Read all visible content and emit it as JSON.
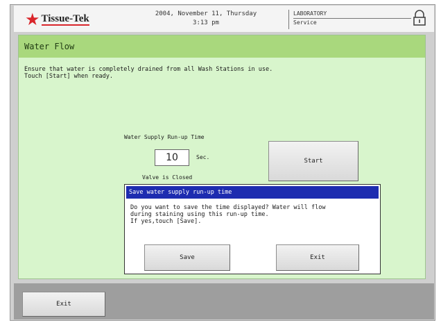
{
  "header": {
    "logo_text": "Tissue-Tek",
    "date_line": "2004, November 11, Thursday",
    "time_line": "3:13 pm",
    "dept_line1": "LABORATORY",
    "dept_line2": "Service",
    "lock_icon": "lock-icon"
  },
  "panel": {
    "title": "Water Flow",
    "instructions": "Ensure that water is completely drained from all Wash Stations in use.\nTouch [Start] when ready.",
    "runup_label": "Water Supply Run-up Time",
    "runup_value": "10",
    "runup_unit": "Sec.",
    "valve_status": "Valve is Closed",
    "start_label": "Start"
  },
  "dialog": {
    "title": "Save water supply run-up time",
    "message": "Do you want to save the time displayed?  Water will flow\nduring staining using this run-up time.\nIf yes,touch [Save].",
    "save_label": "Save",
    "exit_label": "Exit"
  },
  "footer": {
    "exit_label": "Exit"
  },
  "colors": {
    "panel_bg": "#d8f5cc",
    "title_bar": "#a9d87d",
    "dialog_title_bg": "#1d2cb0",
    "brand_red": "#d9262b"
  }
}
